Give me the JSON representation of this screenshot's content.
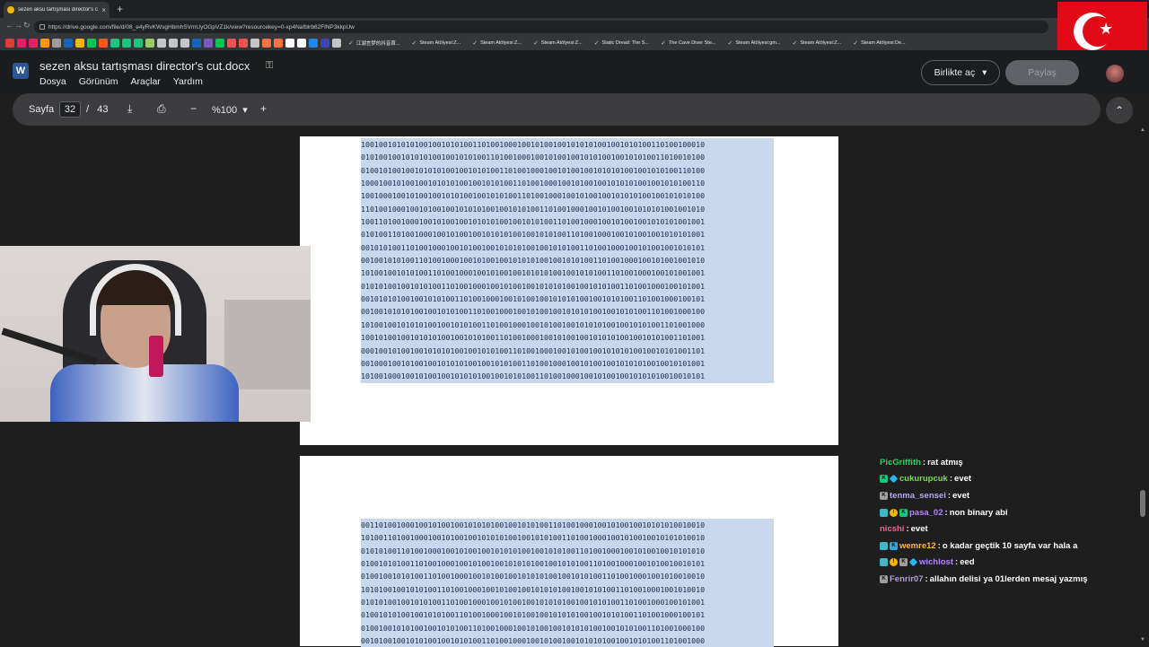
{
  "browser": {
    "tab_title": "sezen aksu tartışması director's cut...",
    "tab_close": "×",
    "new_tab": "+",
    "url": "https://drive.google.com/file/d/08_e4yRvKWsgHbmhSVmUyOGpVZ1k/view?resourcekey=0-xp4Nafblrb62FlNP3kkpUw",
    "bookmarks": [
      {
        "label": "江湖言梦的抖音首...",
        "icon": "tiktok-icon"
      },
      {
        "label": "Steam Atölyesi:Z...",
        "icon": "steam-icon"
      },
      {
        "label": "Steam Atölyesi:Z...",
        "icon": "steam-icon"
      },
      {
        "label": "Steam Atölyesi:Z...",
        "icon": "steam-icon"
      },
      {
        "label": "Static Dread: The S...",
        "icon": "steam-icon"
      },
      {
        "label": "The Cave Diver Ste...",
        "icon": "steam-icon"
      },
      {
        "label": "Steam Atölyesi:gm...",
        "icon": "steam-icon"
      },
      {
        "label": "Steam Atölyesi:Z...",
        "icon": "steam-icon"
      },
      {
        "label": "Steam Atölyesi:De...",
        "icon": "steam-icon"
      }
    ],
    "bookmark_icon_colors": [
      "#e53935",
      "#e91e63",
      "#e91e63",
      "#ff9800",
      "#9e9e9e",
      "#1565c0",
      "#f4b400",
      "#00c853",
      "#ff5722",
      "#1ac47c",
      "#1ac47c",
      "#1ac47c",
      "#9ccc65",
      "#c4c7c5",
      "#c4c7c5",
      "#c4c7c5",
      "#1565c0",
      "#7e57c2",
      "#00c853",
      "#ef5350",
      "#ef5350",
      "#c4c7c5",
      "#ff7043",
      "#ff7043",
      "#ffffff",
      "#ffffff",
      "#1e88e5",
      "#3949ab",
      "#c4c7c5"
    ]
  },
  "viewer": {
    "doc_title": "sezen aksu tartışması director's cut.docx",
    "app_icon": "W",
    "menu": [
      "Dosya",
      "Görünüm",
      "Araçlar",
      "Yardım"
    ],
    "open_with": "Birlikte aç",
    "share": "Paylaş"
  },
  "pagebar": {
    "label": "Sayfa",
    "current_page": "32",
    "separator": "/",
    "total_pages": "43",
    "zoom": "%100",
    "zoom_out": "−",
    "zoom_in": "+",
    "download_icon": "⤓",
    "print_icon": "⎙",
    "caret": "▾",
    "collapse_icon": "⌃"
  },
  "document": {
    "page1_lines": [
      "10010010101010010010101001101001000100101001001010101001001010100110100100010",
      "01010010010101010010010101001101001000100101001001010100100101010011010010100",
      "01001010010010101010010010101001101001000100101001001010101001001010100110100",
      "10001001010010010101010010010101001101001000100101001001010101001001010100110",
      "10010001001010010010101001001010100110100100010010100100101010100100101010100",
      "11010010001001010010010101010010010101001101001000100101001001010101001001010",
      "10011010010001001010010010101010010010101001101001000100101001001010101001001",
      "01010011010010001001010010010101010010010101001101001000100101001001010101001",
      "00101010011010010001001010010010101010010010101001101001000100101001001010101",
      "00100101010011010010001001010010010101010010010101001101001000100101001001010",
      "10100100101010011010010001001010010010101010010010101001101001000100101001001",
      "01010100100101010011010010001001010010010101010010010101001101001000100101001",
      "00101010100100101010011010010001001010010010101010010010101001101001000100101",
      "00100101010100100101010011010010001001010010010101010010010101001101001000100",
      "10100100101010100100101010011010010001001010010010101010010010101001101001000",
      "10010100100101010100100101010011010010001001010010010101010010010101001101001",
      "00010010100100101010100100101010011010010001001010010010101010010010101001101",
      "00100010010100100101010100100101010011010010001001010010010101010010010101001",
      "10100100010010100100101010100100101010011010010001001010010010101010010010101"
    ],
    "page2_lines": [
      "00110100100010010100100101010100100101010011010010001001010010010101010010010",
      "10100110100100010010100100101010100100101010011010010001001010010010101010010",
      "01010100110100100010010100100101010100100101010011010010001001010010010101010",
      "01001010100110100100010010100100101010100100101010011010010001001010010010101",
      "01001001010100110100100010010100100101010100100101010011010010001001010010010",
      "10101001001010100110100100010010100100101010100100101010011010010001001010010",
      "01010100100101010011010010001001010010010101010010010101001101001000100101001",
      "01001010100100101010011010010001001010010010101010010010101001101001000100101",
      "01001001010100100101010011010010001001010010010101010010010101001101001000100",
      "00101001001010100100101010011010010001001010010010101010010010101001101001000"
    ]
  },
  "chat": [
    {
      "user": "PicGriffith",
      "color": "#1ed760",
      "badges": [],
      "text": "rat atmış"
    },
    {
      "user": "cukurupcuk",
      "color": "#7ed957",
      "badges": [
        "b-k",
        "b-gem"
      ],
      "text": "evet"
    },
    {
      "user": "tenma_sensei",
      "color": "#b8a9f0",
      "badges": [
        "b-kw"
      ],
      "text": "evet"
    },
    {
      "user": "pasa_02",
      "color": "#b388ff",
      "badges": [
        "b-hd",
        "b-coin",
        "b-k"
      ],
      "text": "non binary abi"
    },
    {
      "user": "nicshi",
      "color": "#f06292",
      "badges": [],
      "text": "evet"
    },
    {
      "user": "wemre12",
      "color": "#ffb74d",
      "badges": [
        "b-hd",
        "b-kb"
      ],
      "text": "o kadar geçtik 10 sayfa var hala a"
    },
    {
      "user": "wichlost",
      "color": "#b388ff",
      "badges": [
        "b-hd",
        "b-coin",
        "b-kw",
        "b-gem"
      ],
      "text": "eed"
    },
    {
      "user": "Fenrir07",
      "color": "#b39ddb",
      "badges": [
        "b-kw"
      ],
      "text": "allahın delisi ya 01lerden mesaj yazmış"
    }
  ]
}
